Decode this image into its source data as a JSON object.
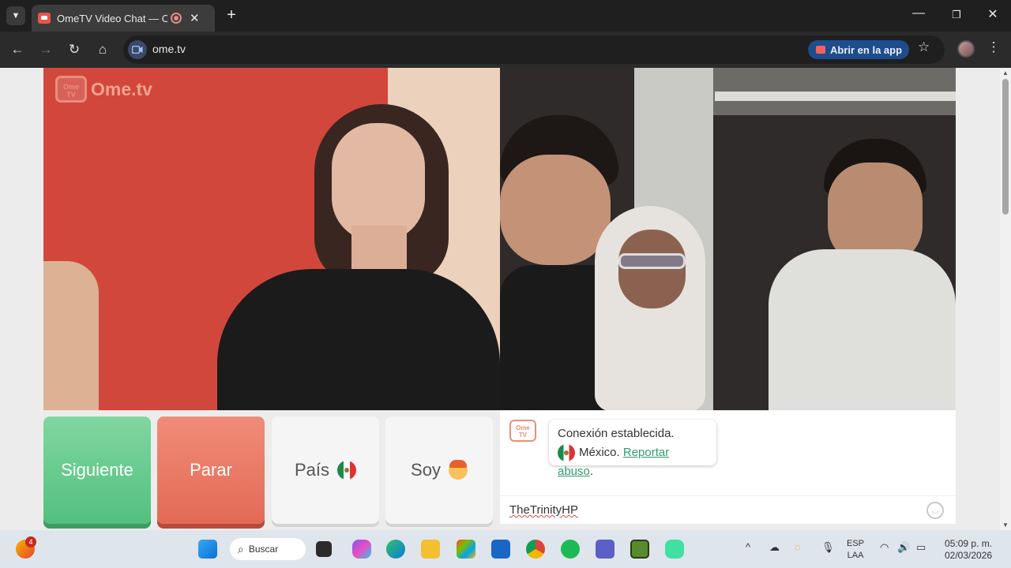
{
  "browser": {
    "tab_title": "OmeTV Video Chat — OmeTV",
    "url": "ome.tv",
    "open_app_label": "Abrir en la app"
  },
  "site": {
    "logo_icon_text": "Ome\nTV",
    "logo_text": "Ome.tv",
    "buttons": {
      "next": "Siguiente",
      "stop": "Parar",
      "country": "País",
      "gender": "Soy"
    },
    "chat": {
      "logo_icon_text": "Ome\nTV",
      "connection_message": "Conexión establecida.",
      "country_name": "México.",
      "report_link": "Reportar abuso",
      "report_suffix": ".",
      "input_value": "TheTrinityHP"
    }
  },
  "taskbar": {
    "notification_count": "4",
    "search_label": "Buscar",
    "language_line1": "ESP",
    "language_line2": "LAA",
    "time": "05:09 p. m.",
    "date": "02/03/2026"
  },
  "colors": {
    "accent_green": "#53c07e",
    "accent_red": "#e36a55",
    "link_green": "#2f9b6e",
    "brand": "#e88f7a"
  }
}
